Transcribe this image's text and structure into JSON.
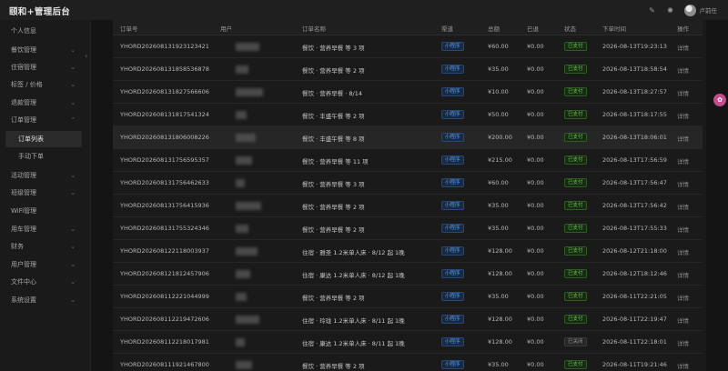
{
  "app": {
    "title": "颐和+管理后台"
  },
  "user": {
    "name": "卢前任"
  },
  "sidebar": {
    "items": [
      {
        "label": "个人信息",
        "chevron": false
      },
      {
        "label": "餐饮管理",
        "chevron": true
      },
      {
        "label": "住宿管理",
        "chevron": true
      },
      {
        "label": "标签 / 价格",
        "chevron": true
      },
      {
        "label": "退款管理",
        "chevron": true
      },
      {
        "label": "订单管理",
        "chevron": true,
        "open": true
      },
      {
        "label": "订单列表",
        "sub": true,
        "active": true
      },
      {
        "label": "手动下单",
        "sub": true
      },
      {
        "label": "活动管理",
        "chevron": true
      },
      {
        "label": "班级管理",
        "chevron": true
      },
      {
        "label": "WiFi管理",
        "chevron": false
      },
      {
        "label": "用车管理",
        "chevron": true
      },
      {
        "label": "财务",
        "chevron": true
      },
      {
        "label": "用户管理",
        "chevron": true
      },
      {
        "label": "文件中心",
        "chevron": true
      },
      {
        "label": "系统设置",
        "chevron": true
      }
    ]
  },
  "table": {
    "columns": [
      "订单号",
      "用户",
      "订单名称",
      "渠道",
      "总额",
      "已退",
      "状态",
      "下单时间",
      "操作"
    ],
    "rows": [
      {
        "order_no": "YHORD202608131923123421",
        "user": "",
        "name": "餐饮 · 营养早餐 等 3 项",
        "channel": "小程序",
        "total": "¥60.00",
        "refunded": "¥0.00",
        "status": "已支付",
        "time": "2026-08-13T19:23:13",
        "op": "详情"
      },
      {
        "order_no": "YHORD202608131858536878",
        "user": "",
        "name": "餐饮 · 营养早餐 等 2 项",
        "channel": "小程序",
        "total": "¥35.00",
        "refunded": "¥0.00",
        "status": "已支付",
        "time": "2026-08-13T18:58:54",
        "op": "详情"
      },
      {
        "order_no": "YHORD202608131827566606",
        "user": "",
        "name": "餐饮 · 营养早餐 · 8/14",
        "channel": "小程序",
        "total": "¥10.00",
        "refunded": "¥0.00",
        "status": "已支付",
        "time": "2026-08-13T18:27:57",
        "op": "详情"
      },
      {
        "order_no": "YHORD202608131817541324",
        "user": "",
        "name": "餐饮 · 丰盛午餐 等 2 项",
        "channel": "小程序",
        "total": "¥50.00",
        "refunded": "¥0.00",
        "status": "已支付",
        "time": "2026-08-13T18:17:55",
        "op": "详情"
      },
      {
        "order_no": "YHORD202608131806008226",
        "user": "",
        "name": "餐饮 · 丰盛午餐 等 8 项",
        "channel": "小程序",
        "total": "¥200.00",
        "refunded": "¥0.00",
        "status": "已支付",
        "time": "2026-08-13T18:06:01",
        "op": "详情"
      },
      {
        "order_no": "YHORD202608131756595357",
        "user": "",
        "name": "餐饮 · 营养早餐 等 11 项",
        "channel": "小程序",
        "total": "¥215.00",
        "refunded": "¥0.00",
        "status": "已支付",
        "time": "2026-08-13T17:56:59",
        "op": "详情"
      },
      {
        "order_no": "YHORD202608131756462633",
        "user": "",
        "name": "餐饮 · 营养早餐 等 3 项",
        "channel": "小程序",
        "total": "¥60.00",
        "refunded": "¥0.00",
        "status": "已支付",
        "time": "2026-08-13T17:56:47",
        "op": "详情"
      },
      {
        "order_no": "YHORD202608131756415936",
        "user": "",
        "name": "餐饮 · 营养早餐 等 2 项",
        "channel": "小程序",
        "total": "¥35.00",
        "refunded": "¥0.00",
        "status": "已支付",
        "time": "2026-08-13T17:56:42",
        "op": "详情"
      },
      {
        "order_no": "YHORD202608131755324346",
        "user": "",
        "name": "餐饮 · 营养早餐 等 2 项",
        "channel": "小程序",
        "total": "¥35.00",
        "refunded": "¥0.00",
        "status": "已支付",
        "time": "2026-08-13T17:55:33",
        "op": "详情"
      },
      {
        "order_no": "YHORD202608122118003937",
        "user": "",
        "name": "住宿 · 雅圣 1.2米单人床 · 8/12 起 1晚",
        "channel": "小程序",
        "total": "¥128.00",
        "refunded": "¥0.00",
        "status": "已支付",
        "time": "2026-08-12T21:18:00",
        "op": "详情"
      },
      {
        "order_no": "YHORD202608121812457906",
        "user": "",
        "name": "住宿 · 康达 1.2米单人床 · 8/12 起 1晚",
        "channel": "小程序",
        "total": "¥128.00",
        "refunded": "¥0.00",
        "status": "已支付",
        "time": "2026-08-12T18:12:46",
        "op": "详情"
      },
      {
        "order_no": "YHORD202608112221044999",
        "user": "",
        "name": "餐饮 · 营养早餐 等 2 项",
        "channel": "小程序",
        "total": "¥35.00",
        "refunded": "¥0.00",
        "status": "已支付",
        "time": "2026-08-11T22:21:05",
        "op": "详情"
      },
      {
        "order_no": "YHORD202608112219472606",
        "user": "",
        "name": "住宿 · 玲珑 1.2米单人床 · 8/11 起 1晚",
        "channel": "小程序",
        "total": "¥128.00",
        "refunded": "¥0.00",
        "status": "已支付",
        "time": "2026-08-11T22:19:47",
        "op": "详情"
      },
      {
        "order_no": "YHORD202608112218017981",
        "user": "",
        "name": "住宿 · 康达 1.2米单人床 · 8/11 起 1晚",
        "channel": "小程序",
        "total": "¥128.00",
        "refunded": "¥0.00",
        "status": "已关闭",
        "time": "2026-08-11T22:18:01",
        "op": "详情"
      },
      {
        "order_no": "YHORD202608111921467800",
        "user": "",
        "name": "餐饮 · 营养早餐 等 2 项",
        "channel": "小程序",
        "total": "¥35.00",
        "refunded": "¥0.00",
        "status": "已支付",
        "time": "2026-08-11T19:21:46",
        "op": "详情"
      }
    ]
  },
  "colors": {
    "accent": "#5a9ee8",
    "paid": "#73c55a",
    "float": "#c34c8e"
  }
}
